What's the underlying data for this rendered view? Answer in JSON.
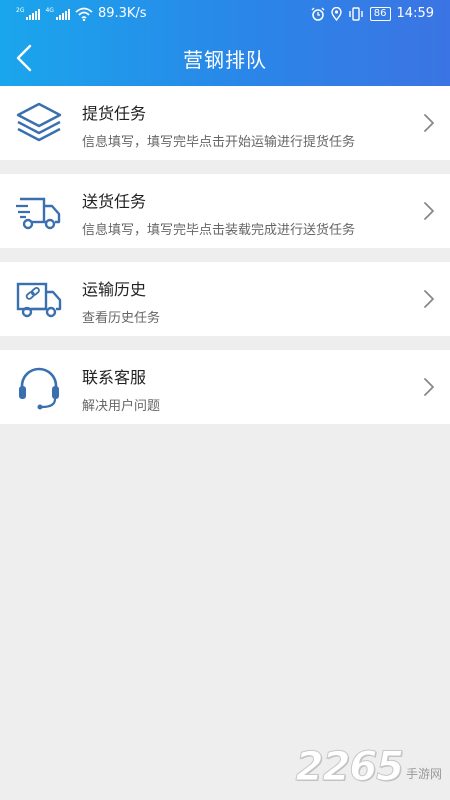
{
  "status_bar": {
    "network_1": "2G",
    "network_2": "4G",
    "speed": "89.3K/s",
    "battery": "86",
    "time": "14:59"
  },
  "header": {
    "title": "营钢排队"
  },
  "menu": [
    {
      "title": "提货任务",
      "subtitle": "信息填写，填写完毕点击开始运输进行提货任务",
      "icon": "layers-icon"
    },
    {
      "title": "送货任务",
      "subtitle": "信息填写，填写完毕点击装载完成进行送货任务",
      "icon": "delivery-truck-icon"
    },
    {
      "title": "运输历史",
      "subtitle": "查看历史任务",
      "icon": "truck-link-icon"
    },
    {
      "title": "联系客服",
      "subtitle": "解决用户问题",
      "icon": "headset-icon"
    }
  ],
  "watermark": {
    "number": "2265",
    "text": "手游网"
  },
  "colors": {
    "header_start": "#1aa6ec",
    "header_end": "#3b74e4",
    "icon_blue": "#3a6fb0",
    "background": "#eeeeee"
  }
}
